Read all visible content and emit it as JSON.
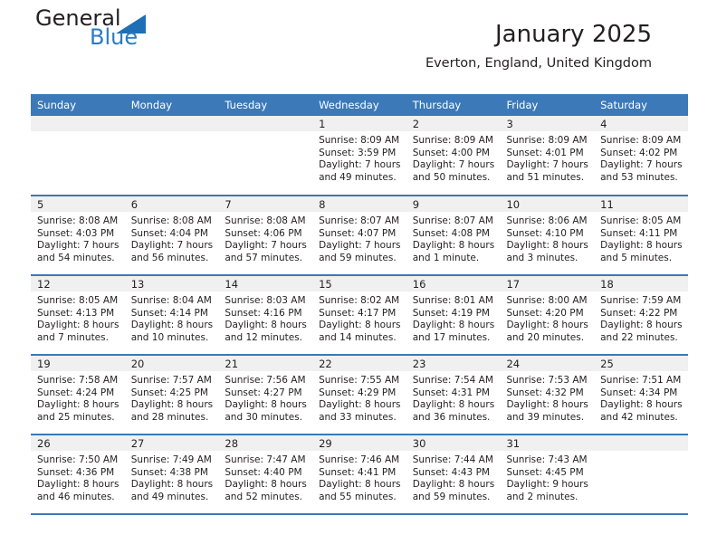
{
  "brand": {
    "logo_primary": "General",
    "logo_secondary": "Blue",
    "logo_shape": "triangle-icon"
  },
  "header": {
    "title": "January 2025",
    "subtitle": "Everton, England, United Kingdom"
  },
  "weekday_headers": [
    "Sunday",
    "Monday",
    "Tuesday",
    "Wednesday",
    "Thursday",
    "Friday",
    "Saturday"
  ],
  "colors": {
    "header_blue": "#3b79b8",
    "logo_blue": "#2b7cc0",
    "daynum_bg": "#f0f0f0",
    "text": "#231f20"
  },
  "weeks": [
    [
      {
        "day": "",
        "sunrise": "",
        "sunset": "",
        "daylight1": "",
        "daylight2": ""
      },
      {
        "day": "",
        "sunrise": "",
        "sunset": "",
        "daylight1": "",
        "daylight2": ""
      },
      {
        "day": "",
        "sunrise": "",
        "sunset": "",
        "daylight1": "",
        "daylight2": ""
      },
      {
        "day": "1",
        "sunrise": "Sunrise: 8:09 AM",
        "sunset": "Sunset: 3:59 PM",
        "daylight1": "Daylight: 7 hours",
        "daylight2": "and 49 minutes."
      },
      {
        "day": "2",
        "sunrise": "Sunrise: 8:09 AM",
        "sunset": "Sunset: 4:00 PM",
        "daylight1": "Daylight: 7 hours",
        "daylight2": "and 50 minutes."
      },
      {
        "day": "3",
        "sunrise": "Sunrise: 8:09 AM",
        "sunset": "Sunset: 4:01 PM",
        "daylight1": "Daylight: 7 hours",
        "daylight2": "and 51 minutes."
      },
      {
        "day": "4",
        "sunrise": "Sunrise: 8:09 AM",
        "sunset": "Sunset: 4:02 PM",
        "daylight1": "Daylight: 7 hours",
        "daylight2": "and 53 minutes."
      }
    ],
    [
      {
        "day": "5",
        "sunrise": "Sunrise: 8:08 AM",
        "sunset": "Sunset: 4:03 PM",
        "daylight1": "Daylight: 7 hours",
        "daylight2": "and 54 minutes."
      },
      {
        "day": "6",
        "sunrise": "Sunrise: 8:08 AM",
        "sunset": "Sunset: 4:04 PM",
        "daylight1": "Daylight: 7 hours",
        "daylight2": "and 56 minutes."
      },
      {
        "day": "7",
        "sunrise": "Sunrise: 8:08 AM",
        "sunset": "Sunset: 4:06 PM",
        "daylight1": "Daylight: 7 hours",
        "daylight2": "and 57 minutes."
      },
      {
        "day": "8",
        "sunrise": "Sunrise: 8:07 AM",
        "sunset": "Sunset: 4:07 PM",
        "daylight1": "Daylight: 7 hours",
        "daylight2": "and 59 minutes."
      },
      {
        "day": "9",
        "sunrise": "Sunrise: 8:07 AM",
        "sunset": "Sunset: 4:08 PM",
        "daylight1": "Daylight: 8 hours",
        "daylight2": "and 1 minute."
      },
      {
        "day": "10",
        "sunrise": "Sunrise: 8:06 AM",
        "sunset": "Sunset: 4:10 PM",
        "daylight1": "Daylight: 8 hours",
        "daylight2": "and 3 minutes."
      },
      {
        "day": "11",
        "sunrise": "Sunrise: 8:05 AM",
        "sunset": "Sunset: 4:11 PM",
        "daylight1": "Daylight: 8 hours",
        "daylight2": "and 5 minutes."
      }
    ],
    [
      {
        "day": "12",
        "sunrise": "Sunrise: 8:05 AM",
        "sunset": "Sunset: 4:13 PM",
        "daylight1": "Daylight: 8 hours",
        "daylight2": "and 7 minutes."
      },
      {
        "day": "13",
        "sunrise": "Sunrise: 8:04 AM",
        "sunset": "Sunset: 4:14 PM",
        "daylight1": "Daylight: 8 hours",
        "daylight2": "and 10 minutes."
      },
      {
        "day": "14",
        "sunrise": "Sunrise: 8:03 AM",
        "sunset": "Sunset: 4:16 PM",
        "daylight1": "Daylight: 8 hours",
        "daylight2": "and 12 minutes."
      },
      {
        "day": "15",
        "sunrise": "Sunrise: 8:02 AM",
        "sunset": "Sunset: 4:17 PM",
        "daylight1": "Daylight: 8 hours",
        "daylight2": "and 14 minutes."
      },
      {
        "day": "16",
        "sunrise": "Sunrise: 8:01 AM",
        "sunset": "Sunset: 4:19 PM",
        "daylight1": "Daylight: 8 hours",
        "daylight2": "and 17 minutes."
      },
      {
        "day": "17",
        "sunrise": "Sunrise: 8:00 AM",
        "sunset": "Sunset: 4:20 PM",
        "daylight1": "Daylight: 8 hours",
        "daylight2": "and 20 minutes."
      },
      {
        "day": "18",
        "sunrise": "Sunrise: 7:59 AM",
        "sunset": "Sunset: 4:22 PM",
        "daylight1": "Daylight: 8 hours",
        "daylight2": "and 22 minutes."
      }
    ],
    [
      {
        "day": "19",
        "sunrise": "Sunrise: 7:58 AM",
        "sunset": "Sunset: 4:24 PM",
        "daylight1": "Daylight: 8 hours",
        "daylight2": "and 25 minutes."
      },
      {
        "day": "20",
        "sunrise": "Sunrise: 7:57 AM",
        "sunset": "Sunset: 4:25 PM",
        "daylight1": "Daylight: 8 hours",
        "daylight2": "and 28 minutes."
      },
      {
        "day": "21",
        "sunrise": "Sunrise: 7:56 AM",
        "sunset": "Sunset: 4:27 PM",
        "daylight1": "Daylight: 8 hours",
        "daylight2": "and 30 minutes."
      },
      {
        "day": "22",
        "sunrise": "Sunrise: 7:55 AM",
        "sunset": "Sunset: 4:29 PM",
        "daylight1": "Daylight: 8 hours",
        "daylight2": "and 33 minutes."
      },
      {
        "day": "23",
        "sunrise": "Sunrise: 7:54 AM",
        "sunset": "Sunset: 4:31 PM",
        "daylight1": "Daylight: 8 hours",
        "daylight2": "and 36 minutes."
      },
      {
        "day": "24",
        "sunrise": "Sunrise: 7:53 AM",
        "sunset": "Sunset: 4:32 PM",
        "daylight1": "Daylight: 8 hours",
        "daylight2": "and 39 minutes."
      },
      {
        "day": "25",
        "sunrise": "Sunrise: 7:51 AM",
        "sunset": "Sunset: 4:34 PM",
        "daylight1": "Daylight: 8 hours",
        "daylight2": "and 42 minutes."
      }
    ],
    [
      {
        "day": "26",
        "sunrise": "Sunrise: 7:50 AM",
        "sunset": "Sunset: 4:36 PM",
        "daylight1": "Daylight: 8 hours",
        "daylight2": "and 46 minutes."
      },
      {
        "day": "27",
        "sunrise": "Sunrise: 7:49 AM",
        "sunset": "Sunset: 4:38 PM",
        "daylight1": "Daylight: 8 hours",
        "daylight2": "and 49 minutes."
      },
      {
        "day": "28",
        "sunrise": "Sunrise: 7:47 AM",
        "sunset": "Sunset: 4:40 PM",
        "daylight1": "Daylight: 8 hours",
        "daylight2": "and 52 minutes."
      },
      {
        "day": "29",
        "sunrise": "Sunrise: 7:46 AM",
        "sunset": "Sunset: 4:41 PM",
        "daylight1": "Daylight: 8 hours",
        "daylight2": "and 55 minutes."
      },
      {
        "day": "30",
        "sunrise": "Sunrise: 7:44 AM",
        "sunset": "Sunset: 4:43 PM",
        "daylight1": "Daylight: 8 hours",
        "daylight2": "and 59 minutes."
      },
      {
        "day": "31",
        "sunrise": "Sunrise: 7:43 AM",
        "sunset": "Sunset: 4:45 PM",
        "daylight1": "Daylight: 9 hours",
        "daylight2": "and 2 minutes."
      },
      {
        "day": "",
        "sunrise": "",
        "sunset": "",
        "daylight1": "",
        "daylight2": ""
      }
    ]
  ]
}
